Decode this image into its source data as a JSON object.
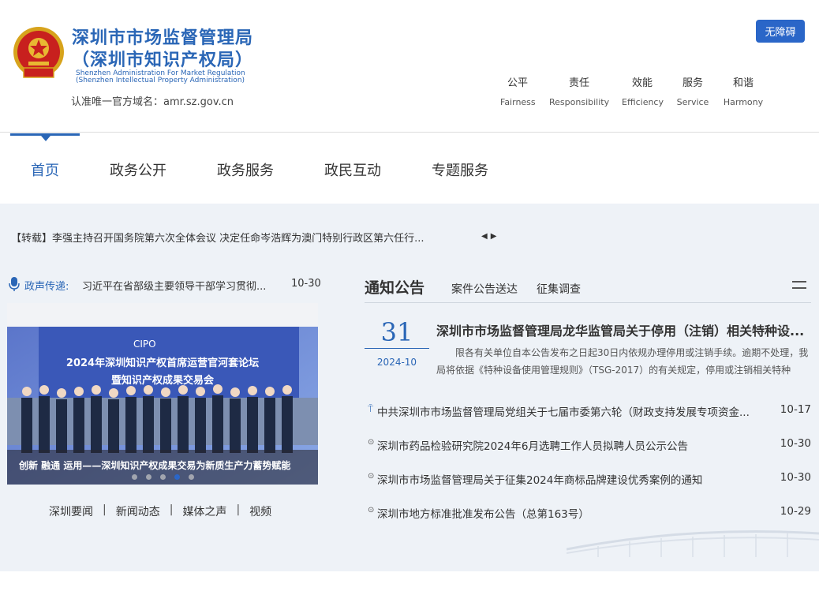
{
  "header": {
    "title_line1": "深圳市市场监督管理局",
    "title_line2": "（深圳市知识产权局）",
    "title_en1": "Shenzhen Administration For Market Regulation",
    "title_en2": "(Shenzhen Intellectual Property Administration)",
    "domain_notice": "认准唯一官方域名：amr.sz.gov.cn",
    "accessibility_button": "无障碍",
    "values": [
      {
        "cn": "公平",
        "en": "Fairness"
      },
      {
        "cn": "责任",
        "en": "Responsibility"
      },
      {
        "cn": "效能",
        "en": "Efficiency"
      },
      {
        "cn": "服务",
        "en": "Service"
      },
      {
        "cn": "和谐",
        "en": "Harmony"
      }
    ],
    "emblem_icon": "national-emblem",
    "accent_color": "#2a66b6"
  },
  "nav": {
    "items": [
      "首页",
      "政务公开",
      "政务服务",
      "政民互动",
      "专题服务"
    ],
    "active": "首页"
  },
  "ticker": {
    "text": "【转载】李强主持召开国务院第六次全体会议 决定任命岑浩辉为澳门特别行政区第六任行...",
    "prev_icon": "◀",
    "next_icon": "▶"
  },
  "voice": {
    "label": "政声传递:",
    "title": "习近平在省部级主要领导干部学习贯彻...",
    "date": "10-30"
  },
  "carousel": {
    "caption": "创新 融通 运用——深圳知识产权成果交易为新质生产力蓄势赋能",
    "banner_logo": "CIPO",
    "banner_line1": "2024年深圳知识产权首席运营官河套论坛",
    "banner_line2": "暨知识产权成果交易会",
    "slides": 5,
    "active_slide": 4
  },
  "sublinks": [
    "深圳要闻",
    "新闻动态",
    "媒体之声",
    "视频"
  ],
  "notice": {
    "title": "通知公告",
    "tabs": [
      "案件公告送达",
      "征集调查"
    ],
    "feature": {
      "day": "31",
      "year_month": "2024-10",
      "title": "深圳市市场监督管理局龙华监管局关于停用（注销）相关特种设...",
      "desc": "限各有关单位自本公告发布之日起30日内依规办理停用或注销手续。逾期不处理，我局将依据《特种设备使用管理规则》（TSG-2017）的有关规定，停用或注销相关特种设..."
    },
    "items": [
      {
        "pinned": true,
        "text": "中共深圳市市场监督管理局党组关于七届市委第六轮（财政支持发展专项资金...",
        "date": "10-17"
      },
      {
        "pinned": false,
        "text": "深圳市药品检验研究院2024年6月选聘工作人员拟聘人员公示公告",
        "date": "10-30"
      },
      {
        "pinned": false,
        "text": "深圳市市场监督管理局关于征集2024年商标品牌建设优秀案例的通知",
        "date": "10-30"
      },
      {
        "pinned": false,
        "text": "深圳市地方标准批准发布公告（总第163号）",
        "date": "10-29"
      }
    ]
  }
}
